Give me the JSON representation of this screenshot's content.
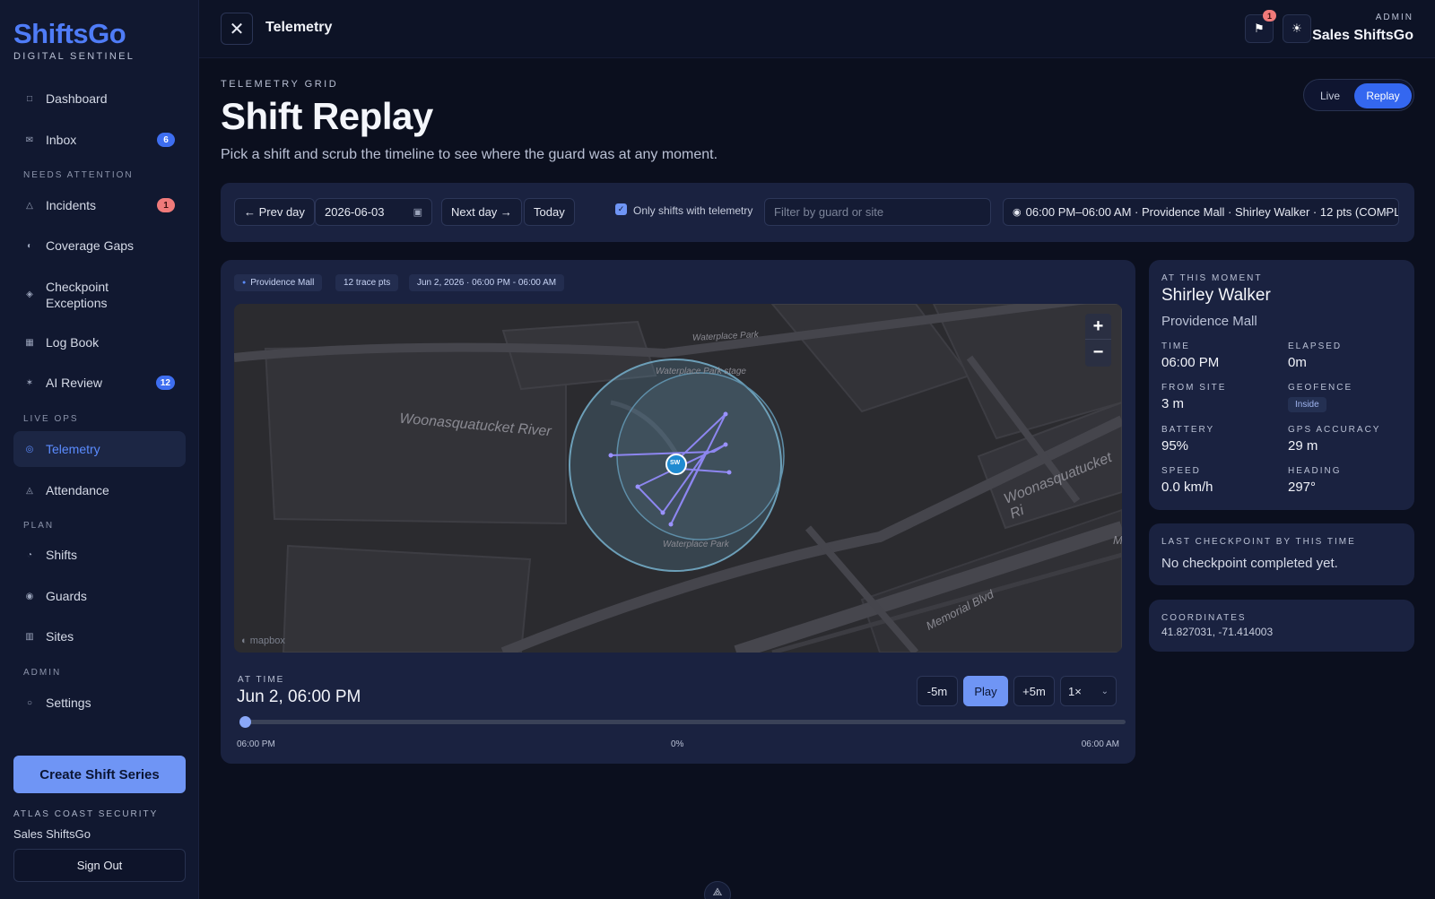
{
  "brand": {
    "name": "ShiftsGo",
    "tagline": "DIGITAL SENTINEL"
  },
  "sidebar": {
    "items": [
      {
        "label": "Dashboard",
        "icon": "square-outline-icon"
      },
      {
        "label": "Inbox",
        "icon": "mail-icon",
        "badge": "6"
      },
      {
        "label": "Incidents",
        "icon": "warning-triangle-icon",
        "badge": "1"
      },
      {
        "label": "Coverage Gaps",
        "icon": "half-circle-icon"
      },
      {
        "label": "Checkpoint Exceptions",
        "icon": "diamond-icon"
      },
      {
        "label": "Log Book",
        "icon": "book-icon"
      },
      {
        "label": "AI Review",
        "icon": "sparkle-icon",
        "badge": "12"
      },
      {
        "label": "Telemetry",
        "icon": "radar-icon",
        "active": true
      },
      {
        "label": "Attendance",
        "icon": "person-icon"
      },
      {
        "label": "Shifts",
        "icon": "clock-icon"
      },
      {
        "label": "Guards",
        "icon": "shield-icon"
      },
      {
        "label": "Sites",
        "icon": "building-icon"
      },
      {
        "label": "Settings",
        "icon": "gear-icon"
      }
    ],
    "sections": [
      "NEEDS ATTENTION",
      "LIVE OPS",
      "PLAN",
      "ADMIN"
    ],
    "create_button": "Create Shift Series",
    "org_name": "ATLAS COAST SECURITY",
    "org_user": "Sales ShiftsGo",
    "sign_out": "Sign Out"
  },
  "topbar": {
    "title": "Telemetry",
    "flag_count": "1",
    "role": "ADMIN",
    "user": "Sales ShiftsGo"
  },
  "header": {
    "eyebrow": "TELEMETRY GRID",
    "title": "Shift Replay",
    "description": "Pick a shift and scrub the timeline to see where the guard was at any moment.",
    "modes": [
      "Live",
      "Replay"
    ],
    "active_mode": "Replay"
  },
  "filters": {
    "prev_day": "← Prev day",
    "date": "2026-06-03",
    "next_day": "Next day →",
    "today": "Today",
    "only_telemetry_label": "Only shifts with telemetry",
    "only_telemetry_checked": true,
    "search_placeholder": "Filter by guard or site",
    "selected_shift": "06:00 PM–06:00 AM · Providence Mall · Shirley Walker · 12 pts (COMPL"
  },
  "map_card": {
    "chips": [
      "Providence Mall",
      "12 trace pts",
      "Jun 2, 2026 · 06:00 PM - 06:00 AM"
    ],
    "map_labels": {
      "river": "Woonasquatucket River",
      "river_right": "Woonasquatucket Ri",
      "park": "Waterplace Park",
      "park_stage": "Waterplace Park stage",
      "park_bottom": "Waterplace Park",
      "blvd": "Memorial Blvd",
      "edge": "M"
    },
    "marker_initials": "SW",
    "attribution": "mapbox",
    "zoom_in": "+",
    "zoom_out": "−"
  },
  "timeline": {
    "label": "AT TIME",
    "value": "Jun 2, 06:00 PM",
    "minus": "-5m",
    "play": "Play",
    "plus": "+5m",
    "speed": "1×",
    "start": "06:00 PM",
    "progress": "0%",
    "end": "06:00 AM",
    "progress_fraction": 0
  },
  "moment": {
    "label": "AT THIS MOMENT",
    "guard": "Shirley Walker",
    "site": "Providence Mall",
    "time_label": "TIME",
    "time": "06:00 PM",
    "elapsed_label": "ELAPSED",
    "elapsed": "0m",
    "from_site_label": "FROM SITE",
    "from_site": "3 m",
    "geofence_label": "GEOFENCE",
    "geofence": "Inside",
    "battery_label": "BATTERY",
    "battery": "95%",
    "gps_label": "GPS ACCURACY",
    "gps": "29 m",
    "speed_label": "SPEED",
    "speed": "0.0 km/h",
    "heading_label": "HEADING",
    "heading": "297°"
  },
  "checkpoint": {
    "label": "LAST CHECKPOINT BY THIS TIME",
    "value": "No checkpoint completed yet."
  },
  "coordinates": {
    "label": "COORDINATES",
    "value": "41.827031, -71.414003"
  }
}
